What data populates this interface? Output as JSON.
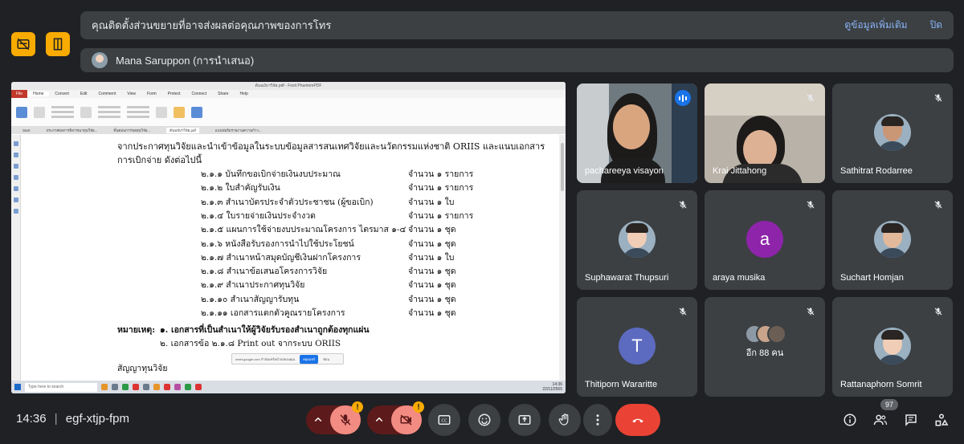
{
  "banner": {
    "warning_text": "คุณติดตั้งส่วนขยายที่อาจส่งผลต่อคุณภาพของการโทร",
    "learn_more": "ดูข้อมูลเพิ่มเติม",
    "close": "ปิด"
  },
  "presenter": {
    "label": "Mana Saruppon (การนำเสนอ)"
  },
  "shared_screen": {
    "title": "ต้นฉบับฯวิจัย.pdf - Foxit PhantomPDF",
    "menu": [
      "File",
      "Home",
      "Convert",
      "Edit",
      "Comment",
      "View",
      "Form",
      "Protect",
      "Connect",
      "Share",
      "Help"
    ],
    "tabs": [
      "Start",
      "ประกาศผลการพิจารณาทุนวิจัย...",
      "ขั้นตอนการขอทุนวิจัย...",
      "ต้นฉบับฯวิจัย.pdf",
      "แบบฟอร์มรายงานความก้าว..."
    ],
    "doc_intro_1": "จากประกาศทุนวิจัยและนำเข้าข้อมูลในระบบข้อมูลสารสนเทศวิจัยและนวัตกรรมแห่งชาติ ORIIS และแนบเอกสาร",
    "doc_intro_2": "การเบิกจ่าย  ดังต่อไปนี้",
    "items": [
      {
        "label": "๒.๑.๑  บันทึกขอเบิกจ่ายเงินงบประมาณ",
        "qty": "จำนวน  ๑ รายการ"
      },
      {
        "label": "๒.๑.๒  ใบสำคัญรับเงิน",
        "qty": "จำนวน  ๑ รายการ"
      },
      {
        "label": "๒.๑.๓  สำเนาบัตรประจำตัวประชาชน (ผู้ขอเบิก)",
        "qty": "จำนวน  ๑  ใบ"
      },
      {
        "label": "๒.๑.๔  ใบรายจ่ายเงินประจำงวด",
        "qty": "จำนวน  ๑ รายการ"
      },
      {
        "label": "๒.๑.๕  แผนการใช้จ่ายงบประมาณโครงการ ไตรมาส ๑-๔",
        "qty": "จำนวน  ๑  ชุด"
      },
      {
        "label": "๒.๑.๖  หนังสือรับรองการนำไปใช้ประโยชน์",
        "qty": "จำนวน  ๑  ชุด"
      },
      {
        "label": "๒.๑.๗  สำเนาหน้าสมุดบัญชีเงินฝากโครงการ",
        "qty": "จำนวน  ๑  ใบ"
      },
      {
        "label": "๒.๑.๘  สำเนาข้อเสนอโครงการวิจัย",
        "qty": "จำนวน  ๑  ชุด"
      },
      {
        "label": "๒.๑.๙  สำเนาประกาศทุนวิจัย",
        "qty": "จำนวน  ๑ ชุด"
      },
      {
        "label": "๒.๑.๑๐  สำเนาสัญญารับทุน",
        "qty": "จำนวน  ๑ ชุด"
      },
      {
        "label": "๒.๑.๑๑  เอกสารแตกตัวคูณรายโครงการ",
        "qty": "จำนวน  ๑ ชุด"
      }
    ],
    "note_label": "หมายเหตุ:",
    "note_1": "๑. เอกสารที่เป็นสำเนาให้ผู้วิจัยรับรองสำเนาถูกต้องทุกแผ่น",
    "note_2": "๒. เอกสารข้อ ๒.๑.๘  Print out จากระบบ ORIIS",
    "footer_line": "สัญญาทุนวิจัย",
    "taskbar_search": "Type here to search",
    "taskbar_time": "14:36",
    "taskbar_date": "22/11/2565",
    "zoom_text": "meet.google.com กำลังแชร์หน้าจอของคุณ",
    "zoom_btn": "หยุดแชร์",
    "zoom_hide": "ซ่อน"
  },
  "participants": [
    {
      "name": "pachareeya visayon",
      "state": "speaking"
    },
    {
      "name": "Krai Jittahong",
      "state": "muted"
    },
    {
      "name": "Sathitrat Rodarree",
      "state": "muted"
    },
    {
      "name": "Suphawarat Thupsuri",
      "state": "muted"
    },
    {
      "name": "araya musika",
      "state": "muted",
      "initial": "a",
      "color": "#8e24aa"
    },
    {
      "name": "Suchart Homjan",
      "state": "muted"
    },
    {
      "name": "Thitiporn Wararitte",
      "state": "muted",
      "initial": "T",
      "color": "#5c6bc0"
    },
    {
      "name": "อีก 88 คน",
      "state": "muted"
    },
    {
      "name": "Rattanaphorn Somrit",
      "state": "muted"
    }
  ],
  "meeting": {
    "time": "14:36",
    "separator": "|",
    "code": "egf-xtjp-fpm",
    "participant_count": "97",
    "warn_glyph": "!"
  },
  "colors": {
    "background": "#202124",
    "tile": "#3c4043",
    "accent_blue": "#8ab4f8",
    "warning": "#f9ab00",
    "end_call": "#ea4335"
  }
}
